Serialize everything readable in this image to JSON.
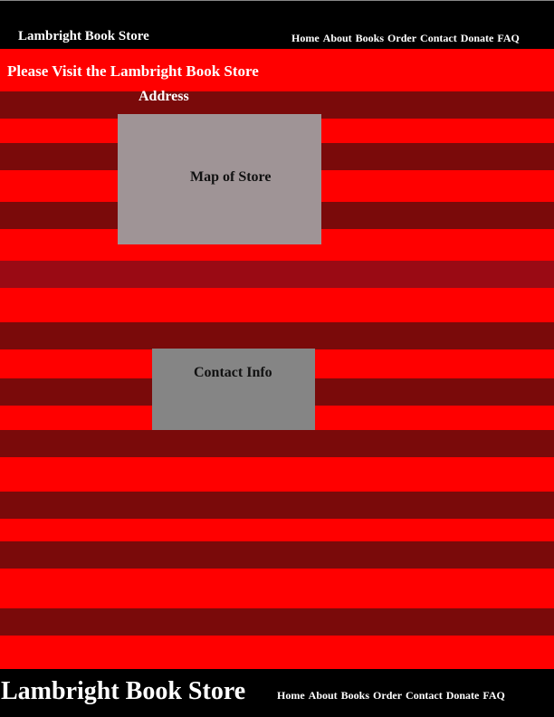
{
  "header": {
    "brand": "Lambright Book Store",
    "nav": [
      "Home",
      "About",
      "Books",
      "Order",
      "Contact",
      "Donate",
      "FAQ"
    ]
  },
  "main": {
    "heading": "Please Visit the Lambright Book Store",
    "address_label": "Address",
    "map_label": "Map of Store",
    "contact_label": "Contact Info"
  },
  "footer": {
    "brand": "Lambright Book Store",
    "nav": [
      "Home",
      "About",
      "Books",
      "Order",
      "Contact",
      "Donate",
      "FAQ"
    ]
  },
  "colors": {
    "bright_red": "#ff0000",
    "dark_red": "#7a0a0a",
    "mid_red": "#9a0a14",
    "bar": "#000000",
    "map_box": "#9f9496",
    "contact_box": "#858585"
  }
}
